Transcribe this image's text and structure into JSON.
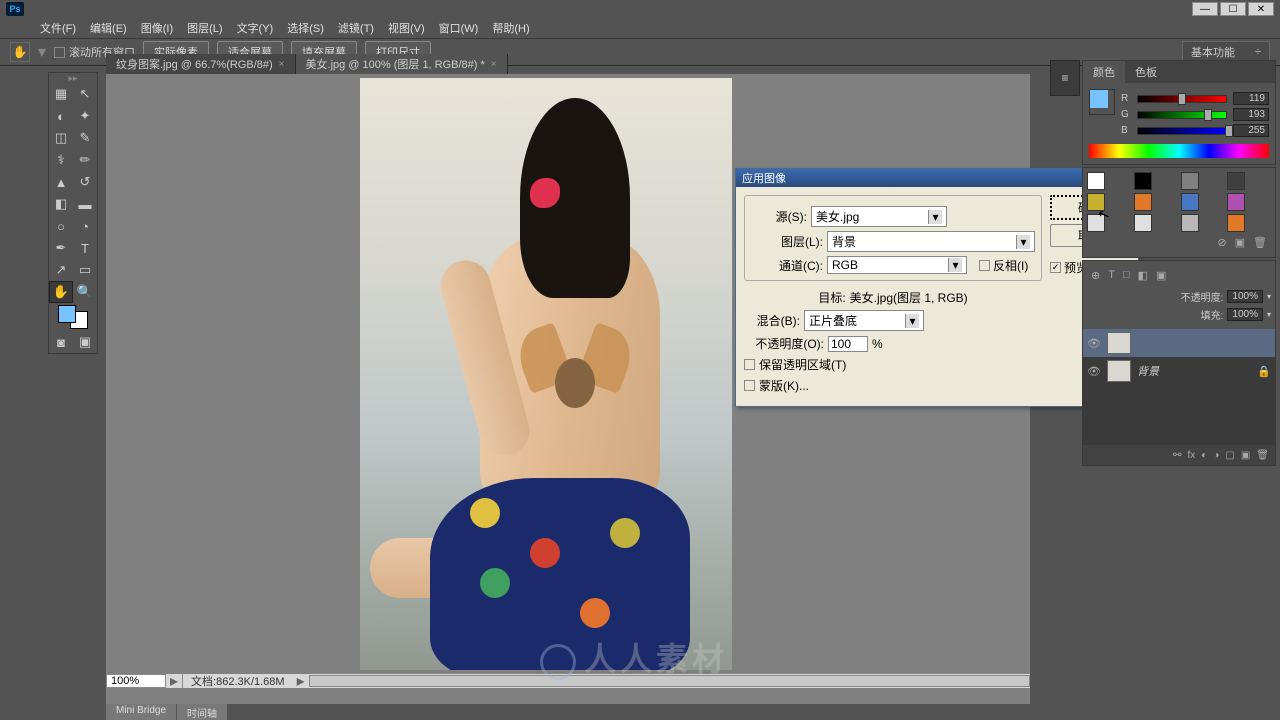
{
  "title_bar": {
    "app": "Ps"
  },
  "menu": [
    "文件(F)",
    "编辑(E)",
    "图像(I)",
    "图层(L)",
    "文字(Y)",
    "选择(S)",
    "滤镜(T)",
    "视图(V)",
    "窗口(W)",
    "帮助(H)"
  ],
  "options": {
    "scroll_all": "滚动所有窗口",
    "btns": [
      "实际像素",
      "适合屏幕",
      "填充屏幕",
      "打印尺寸"
    ],
    "workspace": "基本功能"
  },
  "tabs": [
    {
      "label": "纹身图案.jpg @ 66.7%(RGB/8#)",
      "active": false
    },
    {
      "label": "美女.jpg @ 100% (图层 1, RGB/8#) *",
      "active": true
    }
  ],
  "status": {
    "zoom": "100%",
    "doc": "文档:862.3K/1.68M"
  },
  "bottom_tabs": [
    "Mini Bridge",
    "时间轴"
  ],
  "dialog": {
    "title": "应用图像",
    "source_label": "源(S):",
    "source_val": "美女.jpg",
    "layer_label": "图层(L):",
    "layer_val": "背景",
    "channel_label": "通道(C):",
    "channel_val": "RGB",
    "invert": "反相(I)",
    "target_label": "目标:",
    "target_val": "美女.jpg(图层 1, RGB)",
    "blend_label": "混合(B):",
    "blend_val": "正片叠底",
    "opacity_label": "不透明度(O):",
    "opacity_val": "100",
    "opacity_pct": "%",
    "preserve": "保留透明区域(T)",
    "mask": "蒙版(K)...",
    "ok": "确定",
    "cancel": "取消",
    "preview": "预览(P)"
  },
  "color_panel": {
    "tabs": [
      "颜色",
      "色板"
    ],
    "r": "119",
    "g": "193",
    "b": "255"
  },
  "swatch_colors": [
    "#ffffff",
    "#000000",
    "#808080",
    "#404040",
    "#c8b030",
    "#e07828",
    "#4878c0",
    "#b050b0",
    "#e0e0e0",
    "#e0e0e0",
    "#b8b8b8",
    "#e07828"
  ],
  "layers_panel": {
    "opacity_label": "不透明度:",
    "opacity_val": "100%",
    "fill_label": "填充:",
    "fill_val": "100%",
    "layers": [
      {
        "name": "",
        "sel": true
      },
      {
        "name": "背景",
        "sel": false,
        "locked": true
      }
    ],
    "icon_row": [
      "⊕",
      "T",
      "□",
      "◧",
      "▣"
    ]
  },
  "watermark": "人人素材"
}
